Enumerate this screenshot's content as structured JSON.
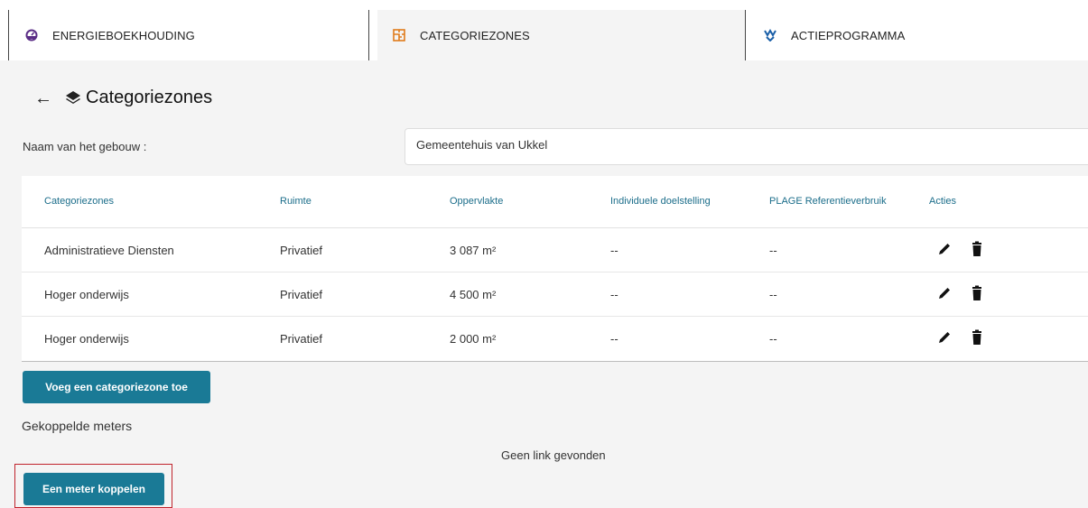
{
  "tabs": [
    {
      "label": "ENERGIEBOEKHOUDING",
      "icon": "gauge-icon"
    },
    {
      "label": "CATEGORIEZONES",
      "icon": "floorplan-icon"
    },
    {
      "label": "ACTIEPROGRAMMA",
      "icon": "action-program-icon"
    }
  ],
  "page": {
    "back_icon": "arrow-left-icon",
    "title_icon": "layers-icon",
    "title": "Categoriezones"
  },
  "building": {
    "label": "Naam van het gebouw :",
    "value": "Gemeentehuis van Ukkel"
  },
  "table": {
    "headers": [
      "Categoriezones",
      "Ruimte",
      "Oppervlakte",
      "Individuele doelstelling",
      "PLAGE Referentieverbruik",
      "Acties"
    ],
    "rows": [
      {
        "zone": "Administratieve Diensten",
        "ruimte": "Privatief",
        "oppervlakte": "3 087 m²",
        "doelstelling": "--",
        "plage": "--"
      },
      {
        "zone": "Hoger onderwijs",
        "ruimte": "Privatief",
        "oppervlakte": "4 500 m²",
        "doelstelling": "--",
        "plage": "--"
      },
      {
        "zone": "Hoger onderwijs",
        "ruimte": "Privatief",
        "oppervlakte": "2 000 m²",
        "doelstelling": "--",
        "plage": "--"
      }
    ]
  },
  "buttons": {
    "add_zone": "Voeg een categoriezone toe",
    "link_meter": "Een meter koppelen"
  },
  "meters": {
    "heading": "Gekoppelde meters",
    "empty": "Geen link gevonden"
  },
  "colors": {
    "accent": "#1a7a96",
    "header_text": "#1b6d8a",
    "tab_icon_orange": "#e07b1a",
    "tab_icon_blue": "#1a5fa8",
    "highlight": "#c0232b"
  }
}
